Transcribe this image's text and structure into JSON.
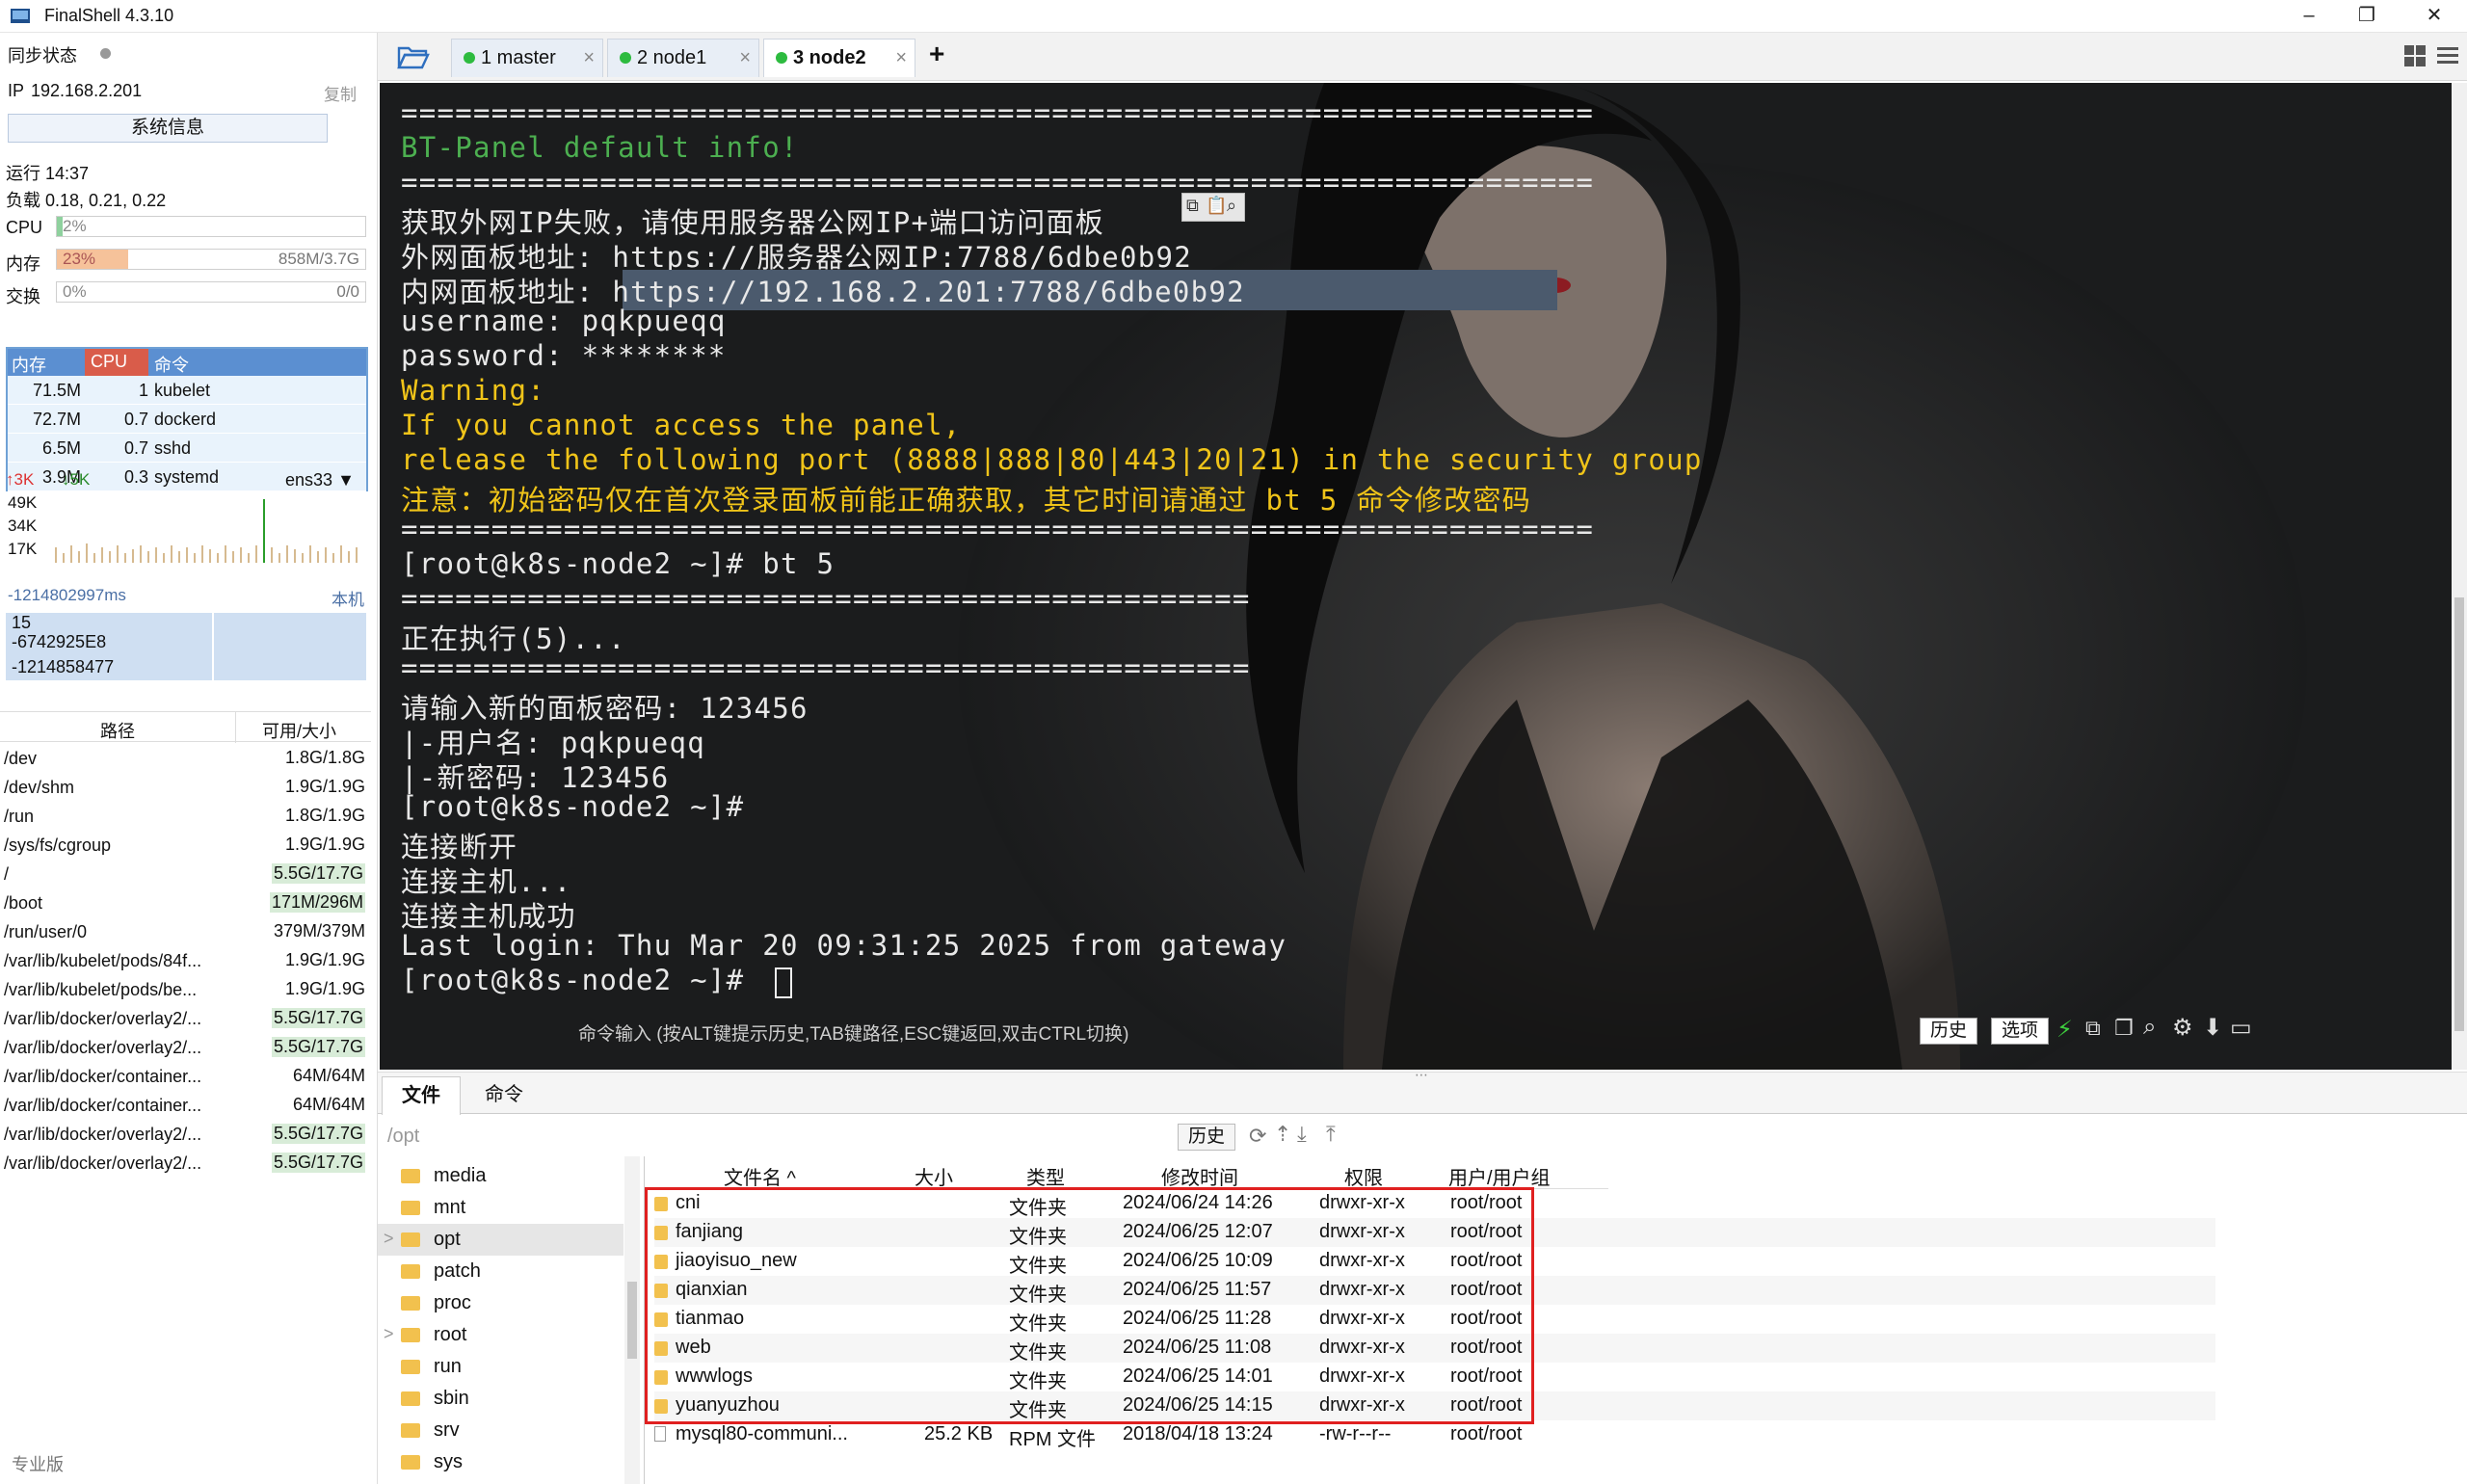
{
  "window": {
    "title": "FinalShell 4.3.10",
    "min": "–",
    "max": "❐",
    "close": "✕"
  },
  "left": {
    "sync_label": "同步状态",
    "ip_label": "IP",
    "ip_value": "192.168.2.201",
    "copy": "复制",
    "sysinfo_button": "系统信息",
    "uptime": "运行 14:37",
    "load": "负载 0.18, 0.21, 0.22",
    "cpu": {
      "label": "CPU",
      "value": "2%",
      "fraction": 0.02
    },
    "mem": {
      "label": "内存",
      "value": "23%",
      "detail": "858M/3.7G",
      "fraction": 0.23
    },
    "swap": {
      "label": "交换",
      "value": "0%",
      "detail": "0/0",
      "fraction": 0
    },
    "proc_headers": [
      "内存",
      "CPU",
      "命令"
    ],
    "procs": [
      {
        "mem": "71.5M",
        "cpu": "1",
        "cmd": "kubelet"
      },
      {
        "mem": "72.7M",
        "cpu": "0.7",
        "cmd": "dockerd"
      },
      {
        "mem": "6.5M",
        "cpu": "0.7",
        "cmd": "sshd"
      },
      {
        "mem": "3.9M",
        "cpu": "0.3",
        "cmd": "systemd"
      }
    ],
    "net": {
      "up": "3K",
      "down": "5K",
      "iface": "ens33",
      "ticks": [
        "49K",
        "34K",
        "17K"
      ]
    },
    "ping": {
      "ms": "-1214802997ms",
      "local": "本机",
      "values": [
        "15",
        "-6742925E8",
        "-1214858477"
      ]
    },
    "fs_headers": [
      "路径",
      "可用/大小"
    ],
    "fs": [
      {
        "path": "/dev",
        "size": "1.8G/1.8G",
        "hl": false
      },
      {
        "path": "/dev/shm",
        "size": "1.9G/1.9G",
        "hl": false
      },
      {
        "path": "/run",
        "size": "1.8G/1.9G",
        "hl": false
      },
      {
        "path": "/sys/fs/cgroup",
        "size": "1.9G/1.9G",
        "hl": false
      },
      {
        "path": "/",
        "size": "5.5G/17.7G",
        "hl": true
      },
      {
        "path": "/boot",
        "size": "171M/296M",
        "hl": true
      },
      {
        "path": "/run/user/0",
        "size": "379M/379M",
        "hl": false
      },
      {
        "path": "/var/lib/kubelet/pods/84f...",
        "size": "1.9G/1.9G",
        "hl": false
      },
      {
        "path": "/var/lib/kubelet/pods/be...",
        "size": "1.9G/1.9G",
        "hl": false
      },
      {
        "path": "/var/lib/docker/overlay2/...",
        "size": "5.5G/17.7G",
        "hl": true
      },
      {
        "path": "/var/lib/docker/overlay2/...",
        "size": "5.5G/17.7G",
        "hl": true
      },
      {
        "path": "/var/lib/docker/container...",
        "size": "64M/64M",
        "hl": false
      },
      {
        "path": "/var/lib/docker/container...",
        "size": "64M/64M",
        "hl": false
      },
      {
        "path": "/var/lib/docker/overlay2/...",
        "size": "5.5G/17.7G",
        "hl": true
      },
      {
        "path": "/var/lib/docker/overlay2/...",
        "size": "5.5G/17.7G",
        "hl": true
      }
    ],
    "edition": "专业版"
  },
  "tabs": [
    {
      "label": "1 master"
    },
    {
      "label": "2 node1"
    },
    {
      "label": "3 node2"
    }
  ],
  "tab_add": "+",
  "terminal": {
    "lines": [
      {
        "t": "==================================================================",
        "c": ""
      },
      {
        "t": "BT-Panel default info!",
        "c": "g"
      },
      {
        "t": "==================================================================",
        "c": ""
      },
      {
        "t": "获取外网IP失败，请使用服务器公网IP+端口访问面板",
        "c": ""
      },
      {
        "t": "外网面板地址: https://服务器公网IP:7788/6dbe0b92",
        "c": ""
      },
      {
        "t": "内网面板地址: https://192.168.2.201:7788/6dbe0b92",
        "c": ""
      },
      {
        "t": "username: pqkpueqq",
        "c": ""
      },
      {
        "t": "password: ********",
        "c": ""
      },
      {
        "t": "Warning:",
        "c": "y"
      },
      {
        "t": "If you cannot access the panel,",
        "c": "y"
      },
      {
        "t": "release the following port (8888|888|80|443|20|21) in the security group",
        "c": "y"
      },
      {
        "t": "注意：初始密码仅在首次登录面板前能正确获取，其它时间请通过 bt 5 命令修改密码",
        "c": "y"
      },
      {
        "t": "==================================================================",
        "c": ""
      },
      {
        "t": "[root@k8s-node2 ~]# bt 5",
        "c": ""
      },
      {
        "t": "===============================================",
        "c": ""
      },
      {
        "t": "正在执行(5)...",
        "c": ""
      },
      {
        "t": "===============================================",
        "c": ""
      },
      {
        "t": "请输入新的面板密码: 123456",
        "c": ""
      },
      {
        "t": "|-用户名: pqkpueqq",
        "c": ""
      },
      {
        "t": "|-新密码: 123456",
        "c": ""
      },
      {
        "t": "[root@k8s-node2 ~]#",
        "c": ""
      },
      {
        "t": "连接断开",
        "c": ""
      },
      {
        "t": "连接主机...",
        "c": ""
      },
      {
        "t": "连接主机成功",
        "c": ""
      },
      {
        "t": "Last login: Thu Mar 20 09:31:25 2025 from gateway",
        "c": ""
      },
      {
        "t": "[root@k8s-node2 ~]# ",
        "c": ""
      }
    ],
    "cmd_hint": "命令输入 (按ALT键提示历史,TAB键路径,ESC键返回,双击CTRL切换)",
    "history": "历史",
    "options": "选项"
  },
  "bottom": {
    "tab_files": "文件",
    "tab_cmd": "命令",
    "path": "/opt",
    "history": "历史",
    "tree": [
      {
        "name": "media",
        "arrow": ""
      },
      {
        "name": "mnt",
        "arrow": ""
      },
      {
        "name": "opt",
        "arrow": ">"
      },
      {
        "name": "patch",
        "arrow": ""
      },
      {
        "name": "proc",
        "arrow": ""
      },
      {
        "name": "root",
        "arrow": ">"
      },
      {
        "name": "run",
        "arrow": ""
      },
      {
        "name": "sbin",
        "arrow": ""
      },
      {
        "name": "srv",
        "arrow": ""
      },
      {
        "name": "sys",
        "arrow": ""
      }
    ],
    "headers": [
      "文件名 ^",
      "大小",
      "类型",
      "修改时间",
      "权限",
      "用户/用户组"
    ],
    "files": [
      {
        "name": "cni",
        "size": "",
        "type": "文件夹",
        "mtime": "2024/06/24 14:26",
        "perm": "drwxr-xr-x",
        "owner": "root/root",
        "dir": true
      },
      {
        "name": "fanjiang",
        "size": "",
        "type": "文件夹",
        "mtime": "2024/06/25 12:07",
        "perm": "drwxr-xr-x",
        "owner": "root/root",
        "dir": true
      },
      {
        "name": "jiaoyisuo_new",
        "size": "",
        "type": "文件夹",
        "mtime": "2024/06/25 10:09",
        "perm": "drwxr-xr-x",
        "owner": "root/root",
        "dir": true
      },
      {
        "name": "qianxian",
        "size": "",
        "type": "文件夹",
        "mtime": "2024/06/25 11:57",
        "perm": "drwxr-xr-x",
        "owner": "root/root",
        "dir": true
      },
      {
        "name": "tianmao",
        "size": "",
        "type": "文件夹",
        "mtime": "2024/06/25 11:28",
        "perm": "drwxr-xr-x",
        "owner": "root/root",
        "dir": true
      },
      {
        "name": "web",
        "size": "",
        "type": "文件夹",
        "mtime": "2024/06/25 11:08",
        "perm": "drwxr-xr-x",
        "owner": "root/root",
        "dir": true
      },
      {
        "name": "wwwlogs",
        "size": "",
        "type": "文件夹",
        "mtime": "2024/06/25 14:01",
        "perm": "drwxr-xr-x",
        "owner": "root/root",
        "dir": true
      },
      {
        "name": "yuanyuzhou",
        "size": "",
        "type": "文件夹",
        "mtime": "2024/06/25 14:15",
        "perm": "drwxr-xr-x",
        "owner": "root/root",
        "dir": true
      },
      {
        "name": "mysql80-communi...",
        "size": "25.2 KB",
        "type": "RPM 文件",
        "mtime": "2018/04/18 13:24",
        "perm": "-rw-r--r--",
        "owner": "root/root",
        "dir": false
      }
    ]
  },
  "colors": {
    "accent": "#5b8fd1",
    "terminal_bg": "#1a1b1c",
    "green": "#4caf50",
    "yellow": "#f0c419",
    "highlight": "#e02020"
  }
}
